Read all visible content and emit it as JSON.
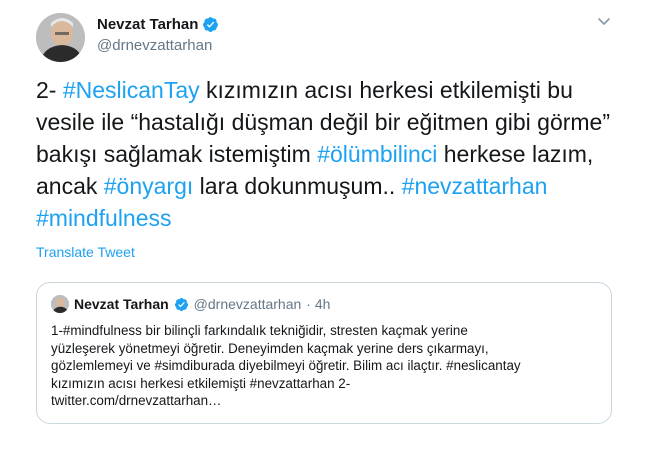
{
  "author": {
    "name": "Nevzat Tarhan",
    "handle": "@drnevzattarhan"
  },
  "tweet": {
    "p1": "2-  ",
    "t1": "#NeslicanTay",
    "p2": " kızımızın acısı herkesi  etkilemişti bu vesile ile “hastalığı düşman değil bir eğitmen gibi görme” bakışı sağlamak istemiştim ",
    "t2": "#ölümbilinci",
    "p3": " herkese lazım, ancak ",
    "t3": "#önyargı",
    "p4": " lara dokunmuşum..  ",
    "t4": "#nevzattarhan",
    "p5": " ",
    "t5": "#mindfulness"
  },
  "translate_label": "Translate Tweet",
  "quoted": {
    "name": "Nevzat Tarhan",
    "handle": "@drnevzattarhan",
    "time": " · 4h",
    "lines": [
      "1-#mindfulness bir bilinçli farkındalık tekniğidir, stresten kaçmak yerine",
      "yüzleşerek yönetmeyi öğretir. Deneyimden kaçmak yerine ders çıkarmayı,",
      "gözlemlemeyi ve #simdiburada diyebilmeyi öğretir. Bilim acı ilaçtır. #neslicantay",
      " kızımızın acısı herkesi etkilemişti #nevzattarhan 2-",
      "twitter.com/drnevzattarhan…"
    ]
  },
  "colors": {
    "link": "#1da1f2",
    "text": "#14171a",
    "secondary": "#657786",
    "border": "#ccd6dd"
  },
  "icons": [
    "avatar",
    "verified-badge-icon",
    "chevron-down-icon"
  ]
}
